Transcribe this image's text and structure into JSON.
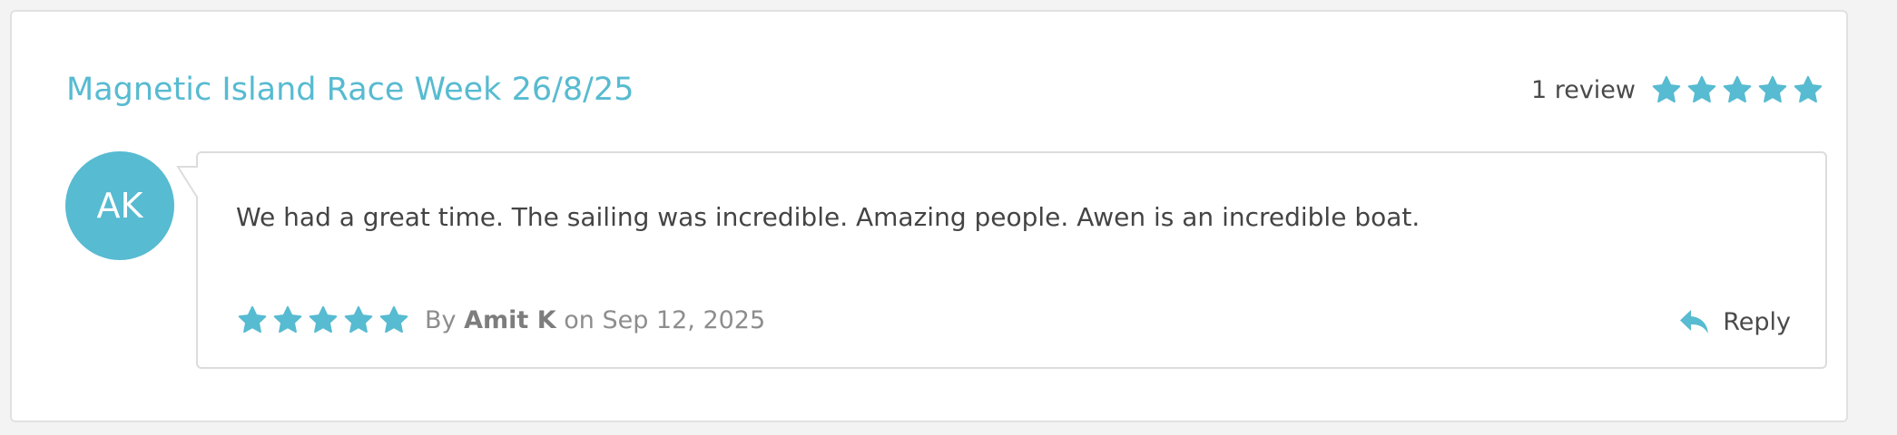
{
  "event": {
    "title": "Magnetic Island Race Week 26/8/25",
    "review_count_label": "1 review",
    "rating": 5,
    "rating_max": 5
  },
  "review": {
    "avatar_initials": "AK",
    "text": "We had a great time. The sailing was incredible. Amazing people. Awen is an incredible boat.",
    "rating": 5,
    "rating_max": 5,
    "by_prefix": "By",
    "author": "Amit K",
    "date_prefix": "on",
    "date": "Sep 12, 2025",
    "reply_label": "Reply"
  },
  "icons": {
    "star": "star-icon",
    "reply": "reply-icon"
  },
  "colors": {
    "accent": "#57bbd1",
    "text": "#444444",
    "muted": "#8d8d8d",
    "border": "#dcdcdc"
  }
}
